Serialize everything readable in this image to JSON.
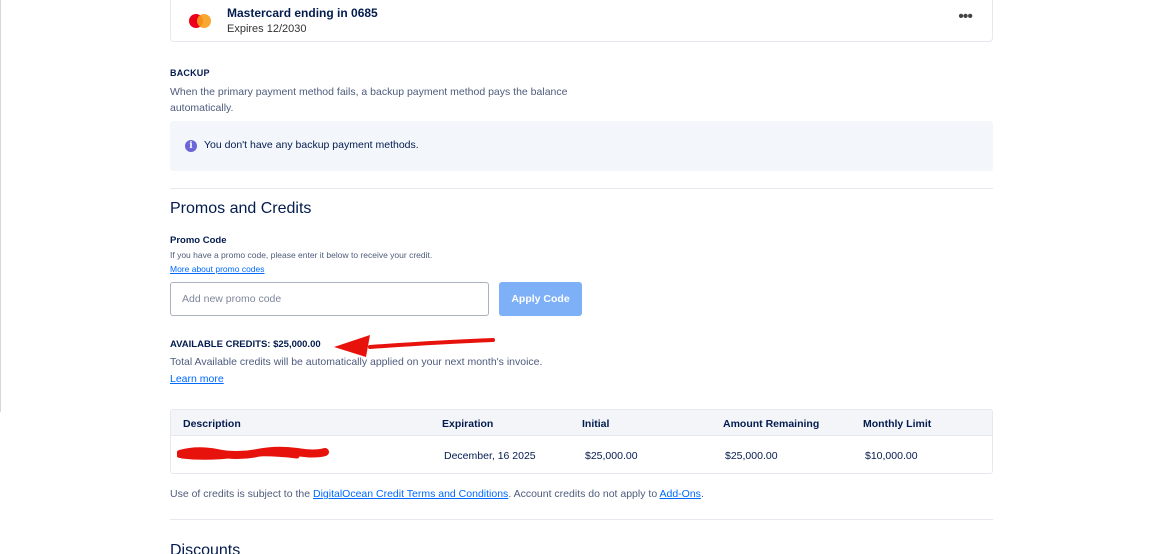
{
  "primary_card": {
    "title": "Mastercard ending in 0685",
    "expiry": "Expires 12/2030",
    "more_label": "•••",
    "logo_icon": "mastercard-logo"
  },
  "backup": {
    "heading": "BACKUP",
    "description": "When the primary payment method fails, a backup payment method pays the balance automatically.",
    "info_icon": "info-icon",
    "info_text": "You don't have any backup payment methods."
  },
  "promos": {
    "title": "Promos and Credits",
    "promo_label": "Promo Code",
    "promo_help": "If you have a promo code, please enter it below to receive your credit.",
    "promo_link": "More about promo codes",
    "input_placeholder": "Add new promo code",
    "input_value": "",
    "apply_label": "Apply Code"
  },
  "credits": {
    "heading": "AVAILABLE CREDITS: $25,000.00",
    "description": "Total Available credits will be automatically applied on your next month's invoice.",
    "learn_more": "Learn more",
    "annotation": {
      "type": "red-arrow",
      "color": "#e8120c"
    }
  },
  "table": {
    "columns": [
      "Description",
      "Expiration",
      "Initial",
      "Amount Remaining",
      "Monthly Limit"
    ],
    "rows": [
      {
        "description": "",
        "description_redacted": true,
        "expiration": "December, 16 2025",
        "initial": "$25,000.00",
        "remaining": "$25,000.00",
        "monthly_limit": "$10,000.00"
      }
    ]
  },
  "terms": {
    "prefix": "Use of credits is subject to the ",
    "link1": "DigitalOcean Credit Terms and Conditions",
    "middle": ". Account credits do not apply to ",
    "link2": "Add-Ons",
    "suffix": "."
  },
  "discounts": {
    "title": "Discounts"
  },
  "colors": {
    "brand_blue": "#0069ff",
    "apply_disabled": "#7eb0f7",
    "text_dark": "#031b4e",
    "info_bg": "#f3f7fb",
    "redaction_red": "#e8120c"
  }
}
